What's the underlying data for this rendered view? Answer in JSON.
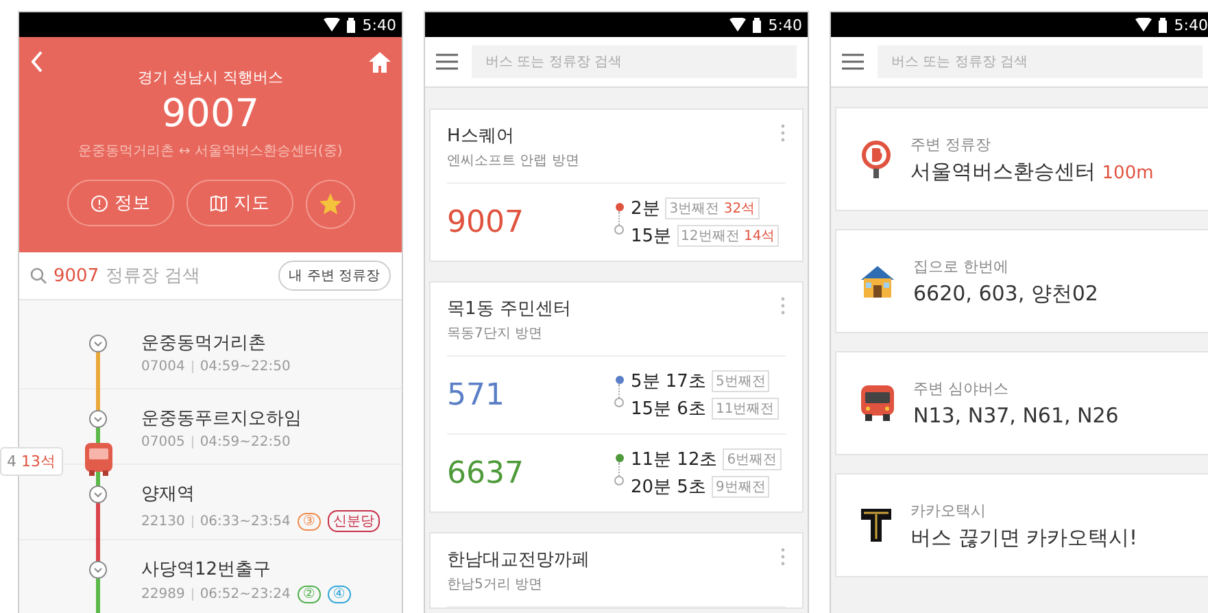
{
  "screens": [
    {
      "kind": "route",
      "status": {
        "time": "5:40"
      },
      "header": {
        "subtitle": "경기 성남시 직행버스",
        "number": "9007",
        "route": "운중동먹거리촌 ↔ 서울역버스환승센터(중)",
        "buttons": [
          {
            "kind": "info",
            "label": "정보"
          },
          {
            "kind": "map",
            "label": "지도"
          }
        ],
        "favorite": true
      },
      "search": {
        "query": "9007",
        "hint": "정류장 검색",
        "nearby_button": "내 주변 정류장"
      },
      "stops": [
        {
          "name": "운중동먹거리촌",
          "code": "07004",
          "hours": "04:59~22:50",
          "color": "#e8a93a"
        },
        {
          "name": "운중동푸르지오하임",
          "code": "07005",
          "hours": "04:59~22:50",
          "color": "#5bb849"
        },
        {
          "name": "양재역",
          "code": "22130",
          "hours": "06:33~23:54",
          "color": "#d9454a",
          "bus": {
            "count": "4",
            "seats": "13석"
          },
          "transfers": [
            {
              "label": "③",
              "color": "#f08a4b"
            },
            {
              "label": "신분당",
              "color": "#c8304a"
            }
          ]
        },
        {
          "name": "사당역12번출구",
          "code": "22989",
          "hours": "06:52~23:24",
          "color": "#5bb849",
          "transfers": [
            {
              "label": "②",
              "color": "#4cb04a"
            },
            {
              "label": "④",
              "color": "#2fa5d9"
            }
          ]
        }
      ]
    },
    {
      "kind": "arrivals",
      "status": {
        "time": "5:40"
      },
      "search": {
        "placeholder": "버스 또는 정류장 검색"
      },
      "cards": [
        {
          "name": "H스퀘어",
          "direction": "엔씨소프트 안랩 방면",
          "routes": [
            {
              "number": "9007",
              "color": "#e0533f",
              "arrivals": [
                {
                  "time": "2분",
                  "info": "3번째전",
                  "seats": "32석"
                },
                {
                  "time": "15분",
                  "info": "12번째전",
                  "seats": "14석"
                }
              ]
            }
          ]
        },
        {
          "name": "목1동 주민센터",
          "direction": "목동7단지 방면",
          "routes": [
            {
              "number": "571",
              "color": "#5a7fc6",
              "arrivals": [
                {
                  "time": "5분 17초",
                  "info": "5번째전"
                },
                {
                  "time": "15분 6초",
                  "info": "11번째전"
                }
              ]
            },
            {
              "number": "6637",
              "color": "#4e9a3a",
              "arrivals": [
                {
                  "time": "11분 12초",
                  "info": "6번째전"
                },
                {
                  "time": "20분 5초",
                  "info": "9번째전"
                }
              ]
            }
          ]
        },
        {
          "name": "한남대교전망까페",
          "direction": "한남5거리 방면"
        }
      ]
    },
    {
      "kind": "home",
      "status": {
        "time": "5:40"
      },
      "search": {
        "placeholder": "버스 또는 정류장 검색"
      },
      "items": [
        {
          "kind": "stop",
          "label": "주변 정류장",
          "value": "서울역버스환승센터",
          "distance": "100m"
        },
        {
          "kind": "home",
          "label": "집으로 한번에",
          "value": "6620, 603, 양천02"
        },
        {
          "kind": "night_bus",
          "label": "주변 심야버스",
          "value": "N13, N37, N61, N26"
        },
        {
          "kind": "taxi",
          "label": "카카오택시",
          "value": "버스 끊기면 카카오택시!"
        }
      ]
    }
  ]
}
